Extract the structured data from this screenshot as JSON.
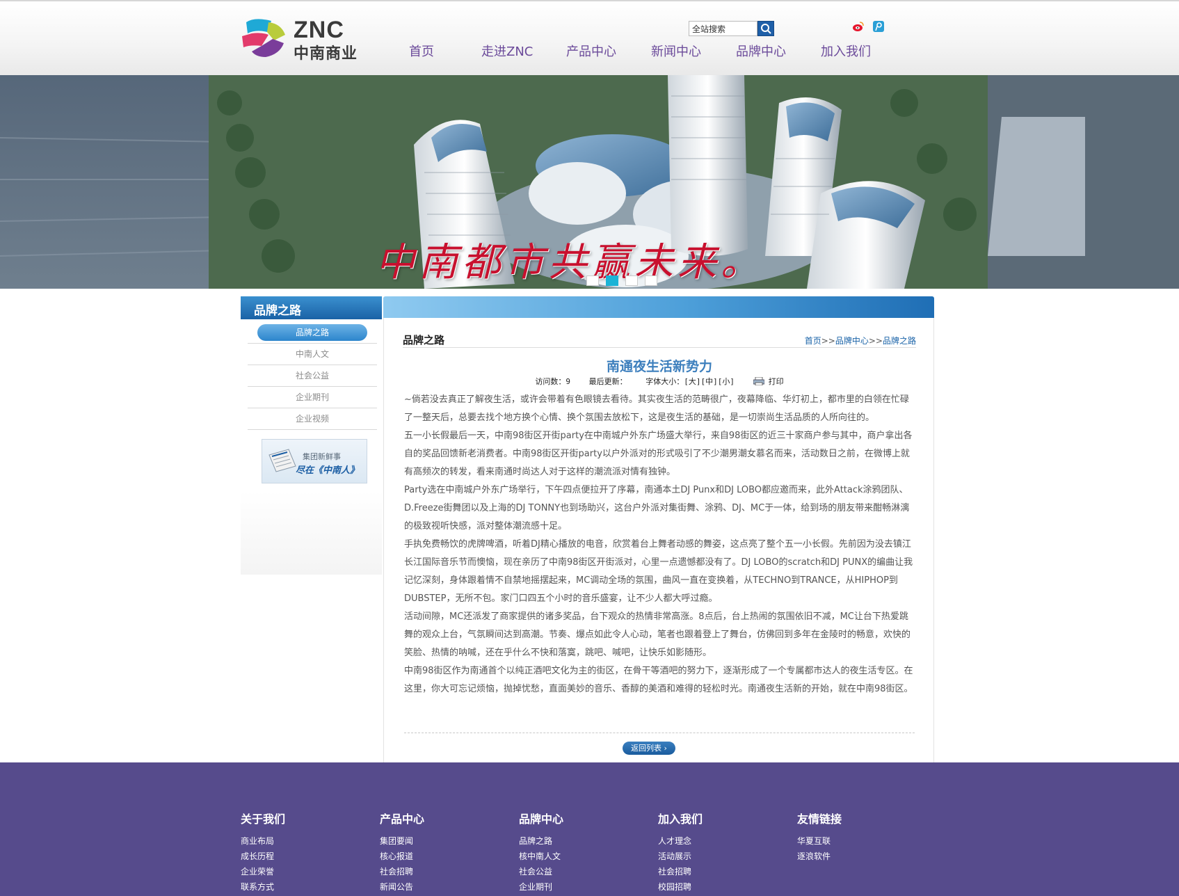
{
  "header": {
    "logo_text": "ZNC",
    "logo_cn": "中南商业",
    "search_placeholder": "全站搜索",
    "nav": [
      "首页",
      "走进ZNC",
      "产品中心",
      "新闻中心",
      "品牌中心",
      "加入我们"
    ]
  },
  "banner": {
    "slogan": "中南都市共赢未来。",
    "slides": 4,
    "active_slide": 2
  },
  "sidebar": {
    "title": "品牌之路",
    "items": [
      "品牌之路",
      "中南人文",
      "社会公益",
      "企业期刊",
      "企业视频"
    ],
    "active": "品牌之路",
    "news_line1": "集团新鲜事",
    "news_line2": "尽在《中南人》"
  },
  "main": {
    "section_title": "品牌之路",
    "breadcrumb": [
      "首页",
      "品牌中心",
      "品牌之路"
    ],
    "breadcrumb_sep": ">>",
    "article_title": "南通夜生活新势力",
    "meta": {
      "views_label": "访问数：",
      "views": "9",
      "updated_label": "最后更新：",
      "font_label": "字体大小：",
      "font_large": "[大]",
      "font_mid": "[中]",
      "font_small": "[小]",
      "print": "打印"
    },
    "paragraphs": [
      "~倘若没去真正了解夜生活，或许会带着有色眼镜去看待。其实夜生活的范畴很广，夜幕降临、华灯初上，都市里的白领在忙碌了一整天后，总要去找个地方换个心情、换个氛围去放松下，这是夜生活的基础，是一切崇尚生活品质的人所向往的。",
      "五一小长假最后一天，中南98街区开街party在中南城户外东广场盛大举行，来自98街区的近三十家商户参与其中，商户拿出各自的奖品回馈新老消费者。中南98街区开街party以户外派对的形式吸引了不少潮男潮女慕名而来，活动数日之前，在微博上就有高频次的转发，看来南通时尚达人对于这样的潮流派对情有独钟。",
      "Party选在中南城户外东广场举行，下午四点便拉开了序幕，南通本土DJ Punx和DJ LOBO都应邀而来，此外Attack涂鸦团队、D.Freeze街舞团以及上海的DJ TONNY也到场助兴，这台户外派对集街舞、涂鸦、DJ、MC于一体，给到场的朋友带来酣畅淋漓的极致视听快感，派对整体潮流感十足。",
      "手执免费畅饮的虎牌啤酒，听着DJ精心播放的电音，欣赏着台上舞者动感的舞姿，这点亮了整个五一小长假。先前因为没去镇江长江国际音乐节而懊恼，现在亲历了中南98街区开街派对，心里一点遗憾都没有了。DJ LOBO的scratch和DJ PUNX的编曲让我记忆深刻，身体跟着情不自禁地摇摆起来，MC调动全场的氛围，曲风一直在变换着，从TECHNO到TRANCE，从HIPHOP到DUBSTEP，无所不包。家门口四五个小时的音乐盛宴，让不少人都大呼过瘾。",
      "活动间隙，MC还派发了商家提供的诸多奖品，台下观众的热情非常高涨。8点后，台上热闹的氛围依旧不减，MC让台下热爱跳舞的观众上台，气氛瞬间达到高潮。节奏、爆点如此令人心动，笔者也跟着登上了舞台，仿佛回到多年在金陵时的畅意，欢快的笑脸、热情的呐喊，还在乎什么不快和落寞，跳吧、喊吧，让快乐如影随形。",
      "中南98街区作为南通首个以纯正酒吧文化为主的街区，在骨干等酒吧的努力下，逐渐形成了一个专属都市达人的夜生活专区。在这里，你大可忘记烦恼，抛掉忧愁，直面美妙的音乐、香醇的美酒和难得的轻松时光。南通夜生活新的开始，就在中南98街区。"
    ],
    "back_label": "返回列表"
  },
  "footer": {
    "columns": [
      {
        "title": "关于我们",
        "items": [
          "商业布局",
          "成长历程",
          "企业荣誉",
          "联系方式"
        ]
      },
      {
        "title": "产品中心",
        "items": [
          "集团要闻",
          "核心报道",
          "社会招聘",
          "新闻公告"
        ]
      },
      {
        "title": "品牌中心",
        "items": [
          "品牌之路",
          "核中南人文",
          "社会公益",
          "企业期刊"
        ]
      },
      {
        "title": "加入我们",
        "items": [
          "人才理念",
          "活动展示",
          "社会招聘",
          "校园招聘"
        ]
      },
      {
        "title": "友情链接",
        "items": [
          "华夏互联",
          "逐浪软件"
        ]
      }
    ]
  },
  "colors": {
    "nav_text": "#6b4a9a",
    "accent_blue": "#1a63a8",
    "article_title": "#3d7fbd",
    "footer_bg": "#564b8c",
    "dot_active": "#1bb3d6"
  }
}
